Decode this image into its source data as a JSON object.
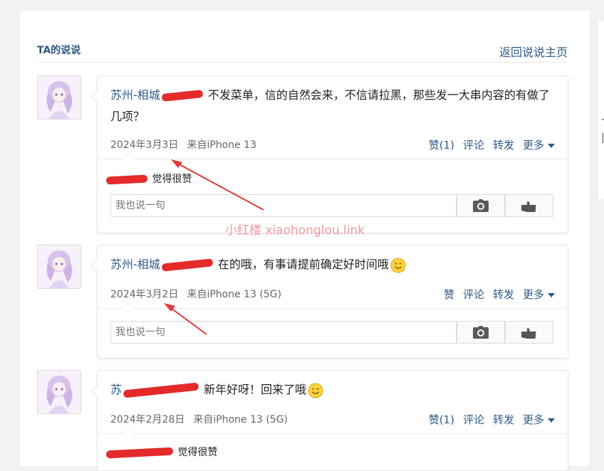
{
  "header": {
    "title": "TA的说说",
    "back_link": "返回说说主页"
  },
  "reply_placeholder": "我也说一句",
  "watermark": "小红楼  xiaohonglou.link",
  "colors": {
    "link": "#2f5a86",
    "redaction": "#e52a2a",
    "text": "#222222"
  },
  "posts": [
    {
      "author_visible": "苏州-相城",
      "text": "不发菜单，信的自然会来，不信请拉黑，那些发一大串内容的有做了几项？",
      "date": "2024年3月3日",
      "source": "来自iPhone 13",
      "like": "赞(1)",
      "comment": "评论",
      "forward": "转发",
      "more": "更多",
      "like_note": "觉得很赞"
    },
    {
      "author_visible": "苏州-相城",
      "text": "在的哦，有事请提前确定好时间哦",
      "date": "2024年3月2日",
      "source": "来自iPhone 13 (5G)",
      "like": "赞",
      "comment": "评论",
      "forward": "转发",
      "more": "更多"
    },
    {
      "author_visible": "苏",
      "text": "新年好呀！回来了哦",
      "date": "2024年2月28日",
      "source": "来自iPhone 13 (5G)",
      "like": "赞(1)",
      "comment": "评论",
      "forward": "转发",
      "more": "更多",
      "like_note": "觉得很赞"
    }
  ]
}
